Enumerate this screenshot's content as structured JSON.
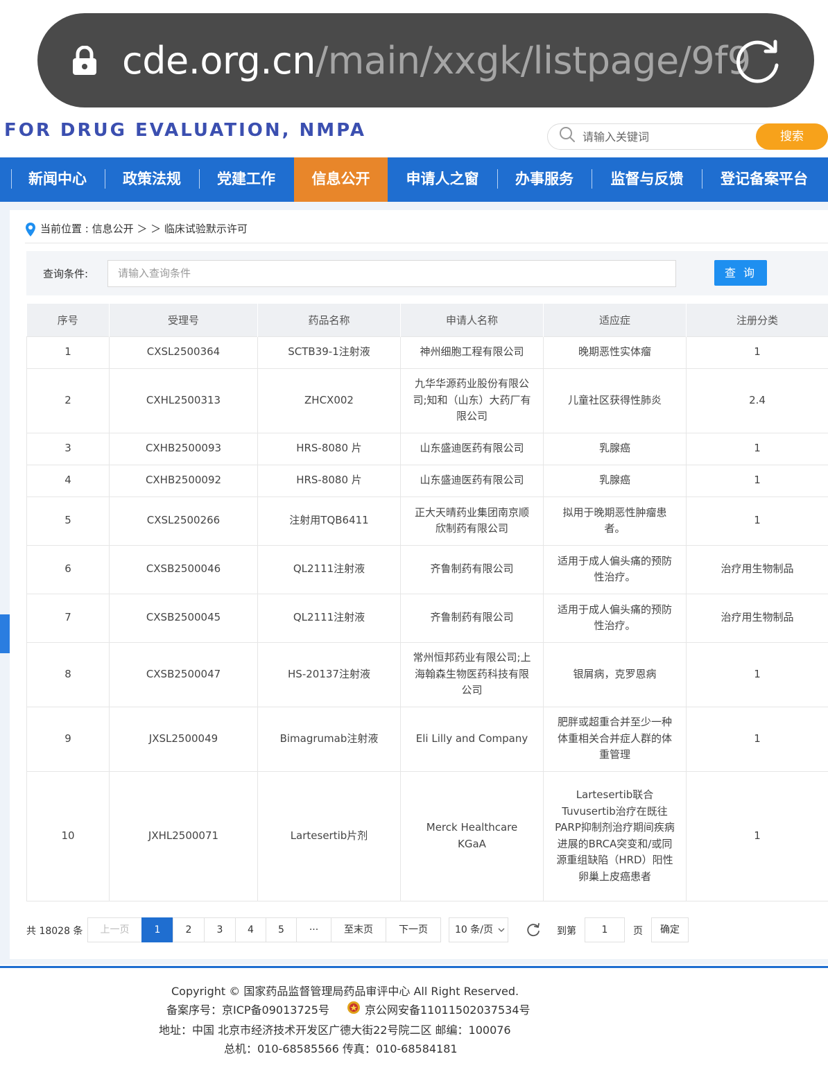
{
  "browser": {
    "url_domain": "cde.org.cn",
    "url_path": "/main/xxgk/listpage/9f9"
  },
  "header": {
    "logo_text": "FOR DRUG EVALUATION, NMPA",
    "search_placeholder": "请输入关键词",
    "search_button": "搜索"
  },
  "nav": {
    "items": [
      {
        "label": "新闻中心"
      },
      {
        "label": "政策法规"
      },
      {
        "label": "党建工作"
      },
      {
        "label": "信息公开"
      },
      {
        "label": "申请人之窗"
      },
      {
        "label": "办事服务"
      },
      {
        "label": "监督与反馈"
      },
      {
        "label": "登记备案平台"
      }
    ],
    "active_index": 3
  },
  "breadcrumb": {
    "text": "当前位置 : 信息公开 ＞ ＞ 临床试验默示许可"
  },
  "query": {
    "label": "查询条件:",
    "placeholder": "请输入查询条件",
    "button": "查 询"
  },
  "table": {
    "headers": [
      "序号",
      "受理号",
      "药品名称",
      "申请人名称",
      "适应症",
      "注册分类"
    ],
    "rows": [
      [
        "1",
        "CXSL2500364",
        "SCTB39-1注射液",
        "神州细胞工程有限公司",
        "晚期恶性实体瘤",
        "1"
      ],
      [
        "2",
        "CXHL2500313",
        "ZHCX002",
        "九华华源药业股份有限公司;知和（山东）大药厂有限公司",
        "儿童社区获得性肺炎",
        "2.4"
      ],
      [
        "3",
        "CXHB2500093",
        "HRS-8080 片",
        "山东盛迪医药有限公司",
        "乳腺癌",
        "1"
      ],
      [
        "4",
        "CXHB2500092",
        "HRS-8080 片",
        "山东盛迪医药有限公司",
        "乳腺癌",
        "1"
      ],
      [
        "5",
        "CXSL2500266",
        "注射用TQB6411",
        "正大天晴药业集团南京顺欣制药有限公司",
        "拟用于晚期恶性肿瘤患者。",
        "1"
      ],
      [
        "6",
        "CXSB2500046",
        "QL2111注射液",
        "齐鲁制药有限公司",
        "适用于成人偏头痛的预防性治疗。",
        "治疗用生物制品"
      ],
      [
        "7",
        "CXSB2500045",
        "QL2111注射液",
        "齐鲁制药有限公司",
        "适用于成人偏头痛的预防性治疗。",
        "治疗用生物制品"
      ],
      [
        "8",
        "CXSB2500047",
        "HS-20137注射液",
        "常州恒邦药业有限公司;上海翰森生物医药科技有限公司",
        "银屑病，克罗恩病",
        "1"
      ],
      [
        "9",
        "JXSL2500049",
        "Bimagrumab注射液",
        "Eli Lilly and Company",
        "肥胖或超重合并至少一种体重相关合并症人群的体重管理",
        "1"
      ],
      [
        "10",
        "JXHL2500071",
        "Lartesertib片剂",
        "Merck Healthcare KGaA",
        "Lartesertib联合Tuvusertib治疗在既往PARP抑制剂治疗期间疾病进展的BRCA突变和/或同源重组缺陷（HRD）阳性卵巢上皮癌患者",
        "1"
      ]
    ]
  },
  "pager": {
    "total": "共 18028 条",
    "prev": "上一页",
    "pages": [
      "1",
      "2",
      "3",
      "4",
      "5",
      "···"
    ],
    "active_page": "1",
    "last": "至末页",
    "next": "下一页",
    "page_size": "10 条/页",
    "goto_label": "到第",
    "goto_value": "1",
    "page_suffix": "页",
    "confirm": "确定"
  },
  "footer": {
    "copyright": "Copyright © 国家药品监督管理局药品审评中心   All Right Reserved.",
    "icp": "备案序号：京ICP备09013725号",
    "police": "京公网安备11011502037534号",
    "address": "地址：中国 北京市经济技术开发区广德大街22号院二区     邮编：100076",
    "phone": "总机：010-68585566     传真：010-68584181"
  },
  "colors": {
    "nav_blue": "#1f6ed0",
    "active_orange": "#e8862a",
    "search_orange": "#f7a21b",
    "button_blue": "#1e8ff0"
  }
}
